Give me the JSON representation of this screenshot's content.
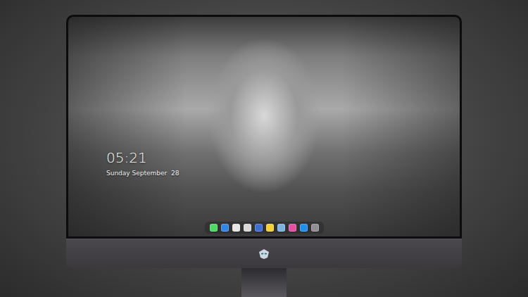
{
  "lock_screen": {
    "time": "05:21",
    "date": "Sunday September  28"
  },
  "dock": {
    "items": [
      {
        "app": "messages",
        "color": "#4cd964"
      },
      {
        "app": "finder",
        "color": "#2f86e6"
      },
      {
        "app": "safari",
        "color": "#e6e6e6"
      },
      {
        "app": "photos",
        "color": "#d9d9d9"
      },
      {
        "app": "movies",
        "color": "#3b6fd6"
      },
      {
        "app": "notes",
        "color": "#f5d033"
      },
      {
        "app": "preview",
        "color": "#7db2e0"
      },
      {
        "app": "music",
        "color": "#e44fa3"
      },
      {
        "app": "app-store",
        "color": "#1f8ff2"
      },
      {
        "app": "camera",
        "color": "#8e8e93"
      }
    ]
  }
}
